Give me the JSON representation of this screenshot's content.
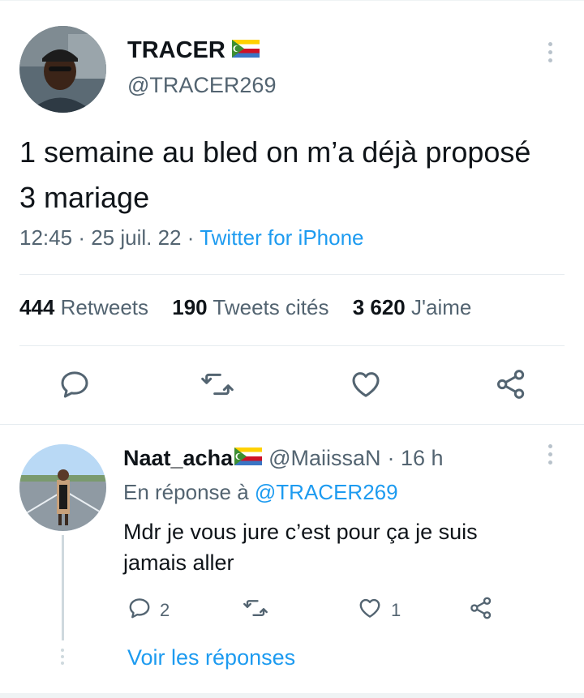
{
  "tweet": {
    "display_name": "TRACER",
    "handle": "@TRACER269",
    "text": "1 semaine au bled on m’a déjà proposé 3 mariage",
    "time": "12:45",
    "date": "25 juil. 22",
    "separator": "·",
    "source": "Twitter for iPhone",
    "stats": {
      "retweets_count": "444",
      "retweets_label": "Retweets",
      "quotes_count": "190",
      "quotes_label": "Tweets cités",
      "likes_count": "3 620",
      "likes_label": "J'aime"
    },
    "actions": [
      "reply-icon",
      "retweet-icon",
      "like-icon",
      "share-icon"
    ]
  },
  "reply": {
    "display_name": "Naat_acha",
    "handle": "@MaiissaN",
    "age": "· 16 h",
    "in_reply_to_label": "En réponse à",
    "in_reply_to_handle": "@TRACER269",
    "text": "Mdr je vous jure c’est pour ça je suis jamais aller",
    "reply_count": "2",
    "retweet_count": "",
    "like_count": "1",
    "show_replies": "Voir les réponses"
  },
  "colors": {
    "text": "#0f1419",
    "secondary": "#536471",
    "accent": "#1d9bf0",
    "divider": "#e6ecf0"
  }
}
